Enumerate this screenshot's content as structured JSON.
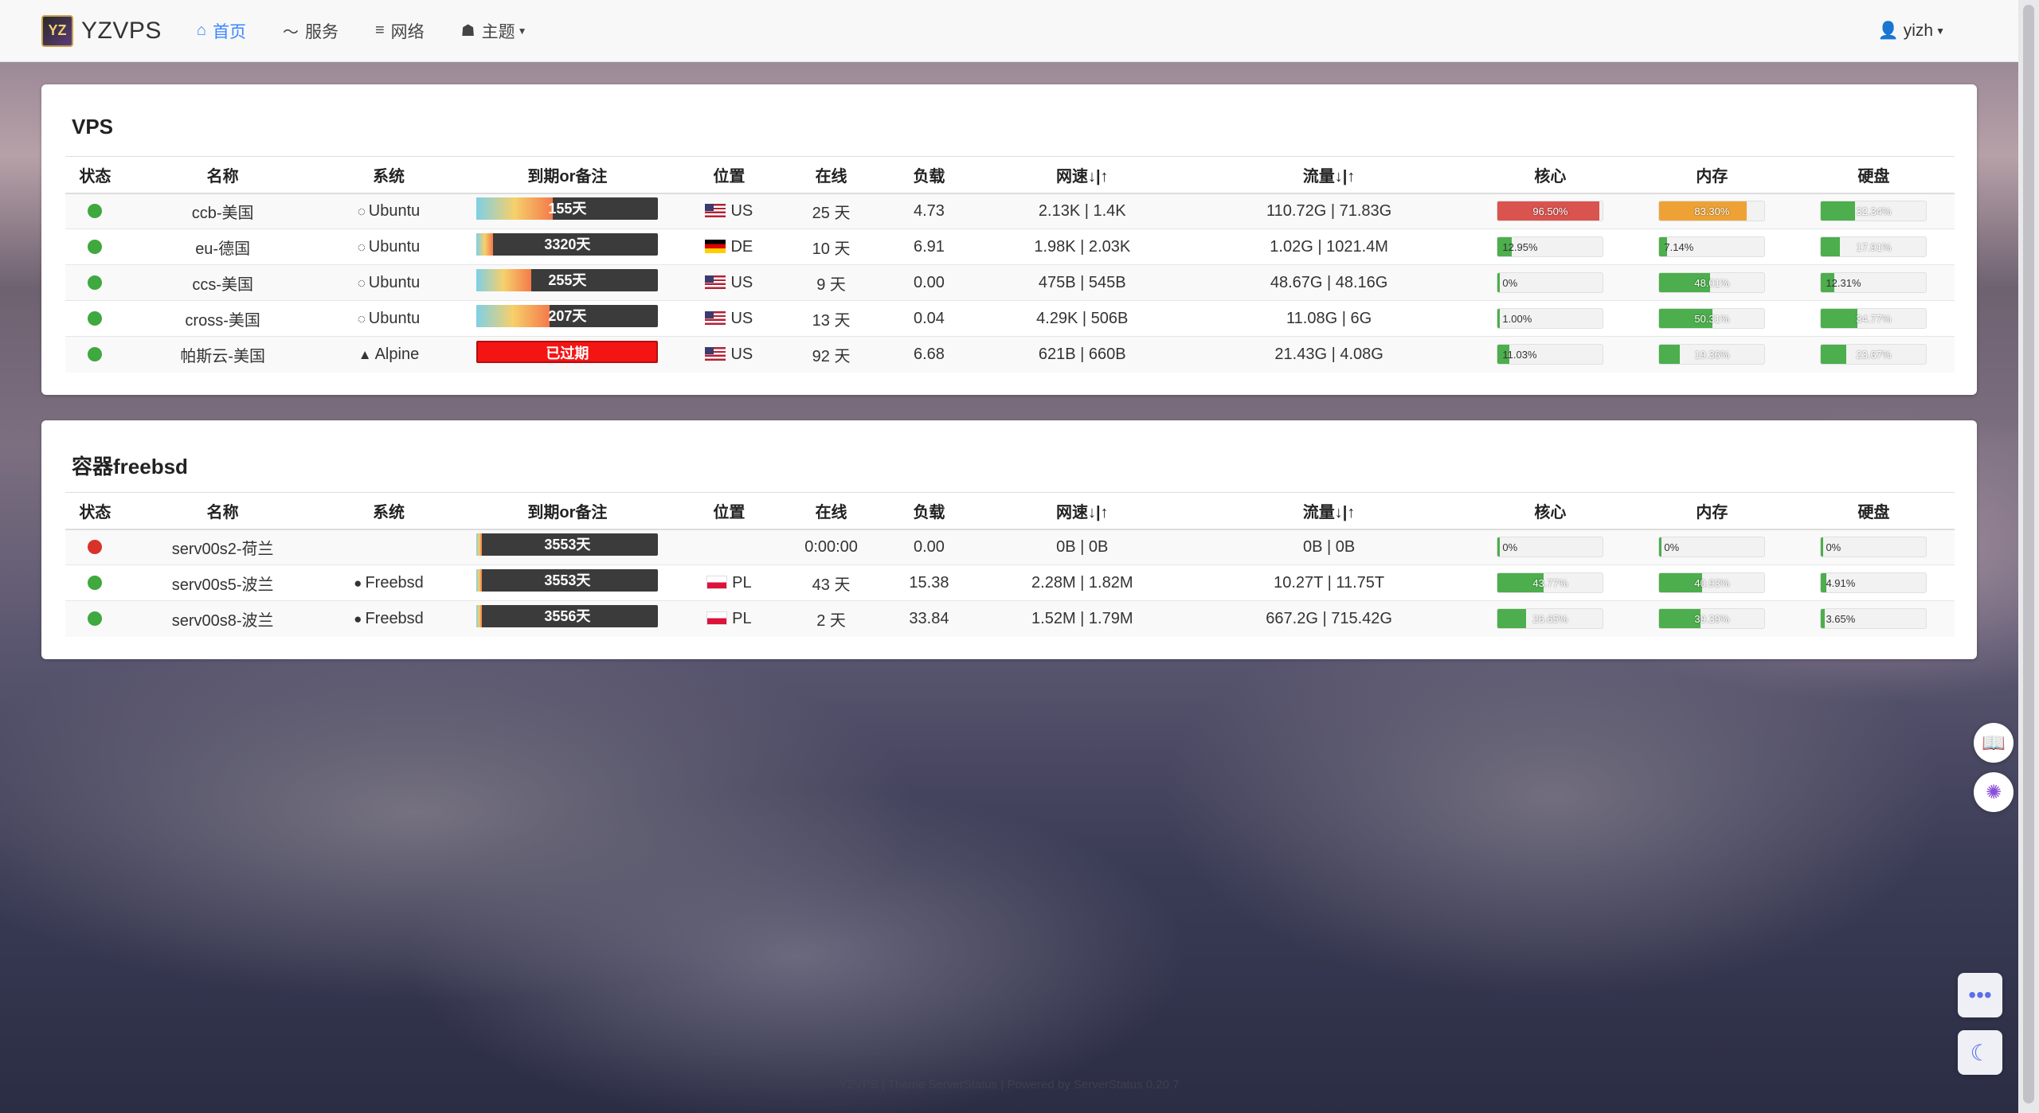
{
  "app": {
    "brand": "YZVPS",
    "logo_text": "YZ"
  },
  "nav": {
    "items": [
      {
        "icon": "home-icon",
        "glyph": "⌂",
        "label": "首页",
        "active": true
      },
      {
        "icon": "rss-icon",
        "glyph": "〜",
        "label": "服务",
        "active": false
      },
      {
        "icon": "network-icon",
        "glyph": "≡",
        "label": "网络",
        "active": false
      },
      {
        "icon": "theme-icon",
        "glyph": "☗",
        "label": "主题",
        "active": false
      }
    ],
    "user": "yizh"
  },
  "vps": {
    "title": "VPS",
    "headers": [
      "状态",
      "名称",
      "系统",
      "到期or备注",
      "位置",
      "在线",
      "负载",
      "网速↓|↑",
      "流量↓|↑",
      "核心",
      "内存",
      "硬盘"
    ],
    "rows": [
      {
        "status": "on",
        "name": "ccb-美国",
        "os": "Ubuntu",
        "expire": "155天",
        "expire_ratio": 0.42,
        "expired": false,
        "flag": "us",
        "loc": "US",
        "uptime": "25 天",
        "load": "4.73",
        "speed": "2.13K | 1.4K",
        "traffic": "110.72G | 71.83G",
        "cpu": "96.50%",
        "cpu_v": 96.5,
        "mem": "83.30%",
        "mem_v": 83.3,
        "disk": "32.34%",
        "disk_v": 32.34
      },
      {
        "status": "on",
        "name": "eu-德国",
        "os": "Ubuntu",
        "expire": "3320天",
        "expire_ratio": 0.09,
        "expired": false,
        "flag": "de",
        "loc": "DE",
        "uptime": "10 天",
        "load": "6.91",
        "speed": "1.98K | 2.03K",
        "traffic": "1.02G | 1021.4M",
        "cpu": "12.95%",
        "cpu_v": 12.95,
        "mem": "7.14%",
        "mem_v": 7.14,
        "disk": "17.91%",
        "disk_v": 17.91
      },
      {
        "status": "on",
        "name": "ccs-美国",
        "os": "Ubuntu",
        "expire": "255天",
        "expire_ratio": 0.3,
        "expired": false,
        "flag": "us",
        "loc": "US",
        "uptime": "9 天",
        "load": "0.00",
        "speed": "475B | 545B",
        "traffic": "48.67G | 48.16G",
        "cpu": "0%",
        "cpu_v": 2,
        "mem": "48.01%",
        "mem_v": 48.01,
        "disk": "12.31%",
        "disk_v": 12.31
      },
      {
        "status": "on",
        "name": "cross-美国",
        "os": "Ubuntu",
        "expire": "207天",
        "expire_ratio": 0.4,
        "expired": false,
        "flag": "us",
        "loc": "US",
        "uptime": "13 天",
        "load": "0.04",
        "speed": "4.29K | 506B",
        "traffic": "11.08G | 6G",
        "cpu": "1.00%",
        "cpu_v": 2,
        "mem": "50.31%",
        "mem_v": 50.31,
        "disk": "34.77%",
        "disk_v": 34.77
      },
      {
        "status": "on",
        "name": "帕斯云-美国",
        "os": "Alpine",
        "expire": "已过期",
        "expire_ratio": 1,
        "expired": true,
        "flag": "us",
        "loc": "US",
        "uptime": "92 天",
        "load": "6.68",
        "speed": "621B | 660B",
        "traffic": "21.43G | 4.08G",
        "cpu": "11.03%",
        "cpu_v": 11.03,
        "mem": "19.36%",
        "mem_v": 19.36,
        "disk": "23.67%",
        "disk_v": 23.67
      }
    ]
  },
  "freebsd": {
    "title": "容器freebsd",
    "headers": [
      "状态",
      "名称",
      "系统",
      "到期or备注",
      "位置",
      "在线",
      "负载",
      "网速↓|↑",
      "流量↓|↑",
      "核心",
      "内存",
      "硬盘"
    ],
    "rows": [
      {
        "status": "off",
        "name": "serv00s2-荷兰",
        "os": "",
        "expire": "3553天",
        "expire_ratio": 0.03,
        "expired": false,
        "flag": "",
        "loc": "",
        "uptime": "0:00:00",
        "load": "0.00",
        "speed": "0B | 0B",
        "traffic": "0B | 0B",
        "cpu": "0%",
        "cpu_v": 2,
        "mem": "0%",
        "mem_v": 2,
        "disk": "0%",
        "disk_v": 2
      },
      {
        "status": "on",
        "name": "serv00s5-波兰",
        "os": "Freebsd",
        "expire": "3553天",
        "expire_ratio": 0.03,
        "expired": false,
        "flag": "pl",
        "loc": "PL",
        "uptime": "43 天",
        "load": "15.38",
        "speed": "2.28M | 1.82M",
        "traffic": "10.27T | 11.75T",
        "cpu": "43.77%",
        "cpu_v": 43.77,
        "mem": "40.93%",
        "mem_v": 40.93,
        "disk": "4.91%",
        "disk_v": 4.91
      },
      {
        "status": "on",
        "name": "serv00s8-波兰",
        "os": "Freebsd",
        "expire": "3556天",
        "expire_ratio": 0.03,
        "expired": false,
        "flag": "pl",
        "loc": "PL",
        "uptime": "2 天",
        "load": "33.84",
        "speed": "1.52M | 1.79M",
        "traffic": "667.2G | 715.42G",
        "cpu": "26.65%",
        "cpu_v": 26.65,
        "mem": "39.39%",
        "mem_v": 39.39,
        "disk": "3.65%",
        "disk_v": 3.65
      }
    ]
  },
  "footer": "YZVPS | Theme ServerStatus | Powered by ServerStatus 0.20.7"
}
